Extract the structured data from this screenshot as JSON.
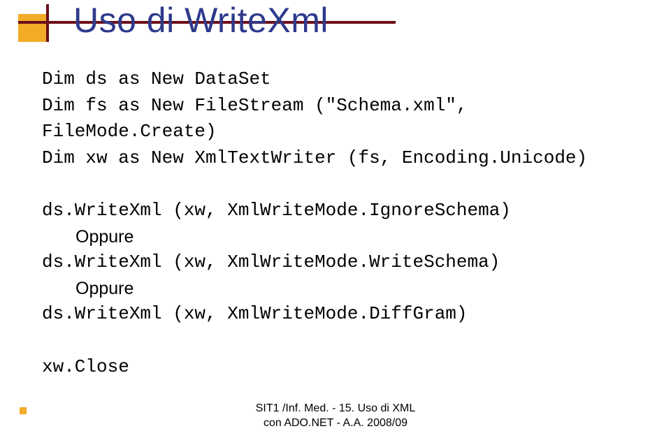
{
  "title": "Uso di WriteXml",
  "code": {
    "l1": "Dim ds as New DataSet",
    "l2": "Dim fs as New FileStream (\"Schema.xml\", FileMode.Create)",
    "l3": "Dim xw as New XmlTextWriter (fs, Encoding.Unicode)",
    "l4": "ds.WriteXml (xw, XmlWriteMode.IgnoreSchema)",
    "or1": "Oppure",
    "l5": "ds.WriteXml (xw, XmlWriteMode.WriteSchema)",
    "or2": "Oppure",
    "l6": "ds.WriteXml (xw, XmlWriteMode.DiffGram)",
    "l7": "xw.Close"
  },
  "footer": {
    "line1": "SIT1 /Inf. Med. - 15. Uso di XML",
    "line2": "con ADO.NET - A.A. 2008/09"
  }
}
